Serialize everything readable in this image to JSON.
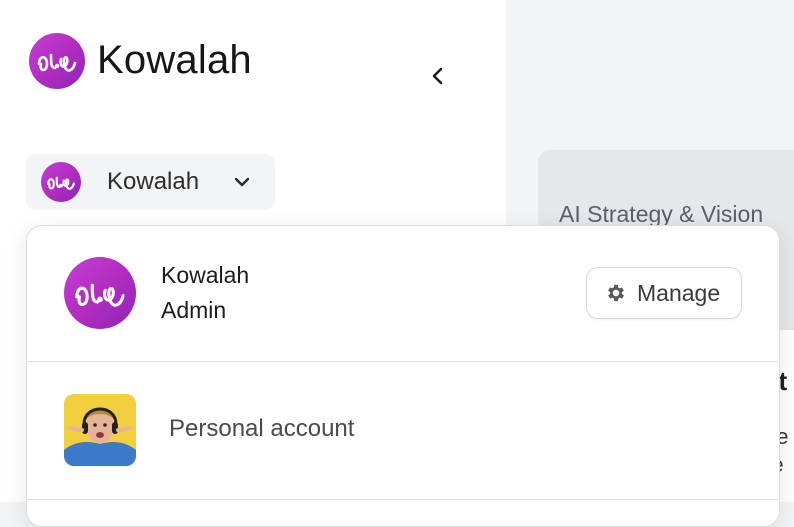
{
  "brand": {
    "name": "Kowalah",
    "logo_icon": "kowalah-logo-icon",
    "accent": "#b32cc0"
  },
  "sidebar": {
    "collapse_icon": "chevron-left-icon",
    "switcher": {
      "label": "Kowalah",
      "chevron_icon": "chevron-down-icon"
    }
  },
  "main": {
    "card_title": "AI Strategy & Vision",
    "right_text_1": "at",
    "right_text_2": "ne",
    "right_text_3": "re"
  },
  "dropdown": {
    "org": {
      "name": "Kowalah",
      "role": "Admin",
      "avatar_icon": "kowalah-logo-icon"
    },
    "manage_button": {
      "label": "Manage",
      "icon": "gear-icon"
    },
    "personal": {
      "label": "Personal account",
      "avatar": "user-photo-avatar"
    }
  }
}
